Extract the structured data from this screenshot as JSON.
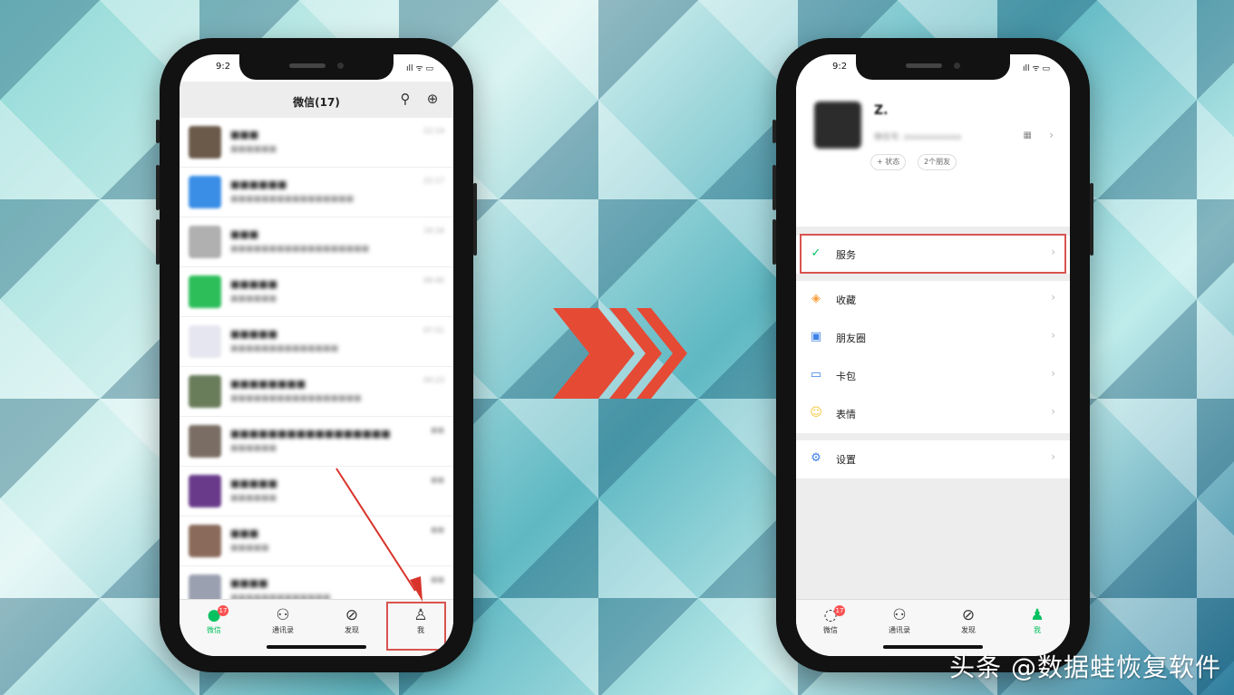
{
  "left_phone": {
    "status_time": "9:2",
    "status_icons": "ıll ᯤ ▭",
    "header_title": "微信(17)",
    "chats": [
      {
        "name": "■■■",
        "preview": "■■■■■■",
        "time": "22:14",
        "color": "#6b5a4a"
      },
      {
        "name": "■■■■■■",
        "preview": "■■■■■■■■■■■■■■■■",
        "time": "22:17",
        "color": "#3a8ee6"
      },
      {
        "name": "■■■",
        "preview": "■■■■■■■■■■■■■■■■■■",
        "time": "19:16",
        "color": "#b0b0b0"
      },
      {
        "name": "■■■■■",
        "preview": "■■■■■■",
        "time": "09:40",
        "color": "#2dbe5a"
      },
      {
        "name": "■■■■■",
        "preview": "■■■■■■■■■■■■■■",
        "time": "07:51",
        "color": "#e6e6f0"
      },
      {
        "name": "■■■■■■■■",
        "preview": "■■■■■■■■■■■■■■■■■",
        "time": "04:23",
        "color": "#6a7d5a"
      },
      {
        "name": "■■■■■■■■■■■■■■■■■",
        "preview": "■■■■■■",
        "time": "■■",
        "color": "#7a6e64"
      },
      {
        "name": "■■■■■",
        "preview": "■■■■■■",
        "time": "■■",
        "color": "#6a3a8a"
      },
      {
        "name": "■■■",
        "preview": "■■■■■",
        "time": "■■",
        "color": "#8a6a5a"
      },
      {
        "name": "■■■■",
        "preview": "■■■■■■■■■■■■■",
        "time": "■■",
        "color": "#9aa0b0"
      }
    ],
    "tabs": [
      {
        "icon": "●",
        "label": "微信",
        "badge": "17"
      },
      {
        "icon": "⚇",
        "label": "通讯录"
      },
      {
        "icon": "⊘",
        "label": "发现"
      },
      {
        "icon": "♙",
        "label": "我"
      }
    ]
  },
  "right_phone": {
    "status_time": "9:2",
    "status_icons": "ıll ᯤ ▭",
    "profile_name": "Z.",
    "profile_id": "微信号: zxxxxxxxxxxx",
    "qr_icon": "▦",
    "chip_status": "+ 状态",
    "chip_friends": "2个朋友",
    "menu": [
      {
        "icon": "✓",
        "label": "服务",
        "color": "#07c160"
      },
      {
        "icon": "◈",
        "label": "收藏",
        "color": "#fa9d3b"
      },
      {
        "icon": "▣",
        "label": "朋友圈",
        "color": "#3d82e6"
      },
      {
        "icon": "▭",
        "label": "卡包",
        "color": "#3d82e6"
      },
      {
        "icon": "☺",
        "label": "表情",
        "color": "#f7c531"
      },
      {
        "icon": "⚙",
        "label": "设置",
        "color": "#3d82e6"
      }
    ],
    "tabs": [
      {
        "icon": "◌",
        "label": "微信",
        "badge": "17"
      },
      {
        "icon": "⚇",
        "label": "通讯录"
      },
      {
        "icon": "⊘",
        "label": "发现"
      },
      {
        "icon": "♟",
        "label": "我"
      }
    ],
    "chevron": "›"
  },
  "watermark": "头条 @数据蛙恢复软件"
}
